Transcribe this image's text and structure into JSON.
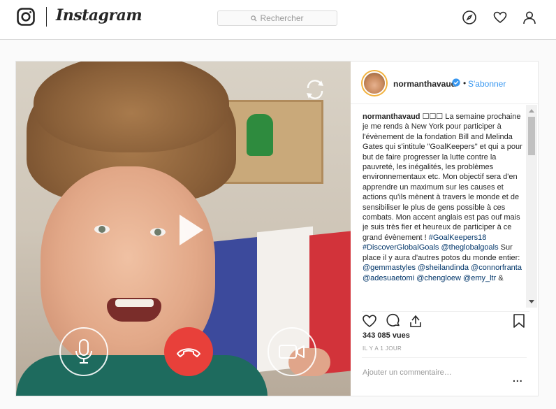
{
  "header": {
    "wordmark": "Instagram",
    "search_placeholder": "Rechercher",
    "icons": [
      "instagram-glyph-icon",
      "compass-icon",
      "heart-icon",
      "profile-icon"
    ]
  },
  "post": {
    "author": {
      "username": "normanthavaud",
      "verified": true,
      "separator": "•",
      "follow_label": "S'abonner"
    },
    "video_controls": {
      "icons": [
        "play-icon",
        "microphone-icon",
        "hang-up-icon",
        "video-camera-icon",
        "reload-icon"
      ]
    },
    "caption": {
      "username": "normanthavaud",
      "emoji": "☐☐☐",
      "text": "La semaine prochaine je me rends à New York pour participer à l'évènement de la fondation Bill and Melinda Gates qui s'intitule \"GoalKeepers\" et qui a pour but de faire progresser la lutte contre la pauvreté, les inégalités, les problèmes environnementaux etc. Mon objectif sera d'en apprendre un maximum sur les causes et actions qu'ils mènent à travers le monde et de sensibiliser le plus de gens possible à ces combats. Mon accent anglais est pas ouf mais je suis très fier et heureux de participer à ce grand évènement !",
      "tags_line1": "#GoalKeepers18",
      "tags_line2": "#DiscoverGlobalGoals @theglobalgoals",
      "mid_text": "Sur place il y aura d'autres potos du monde entier:",
      "tag_gemma": "@gemmastyles",
      "tag_sheil": "@sheilandinda",
      "tag_connor": "@connorfranta",
      "tag_ades": "@adesuaetomi",
      "tag_cheng": "@chengloew",
      "tag_emy": "@emy_ltr",
      "trailing": "&"
    },
    "actions": {
      "icons": [
        "like-icon",
        "comment-icon",
        "share-icon",
        "bookmark-icon"
      ]
    },
    "views": "343 085 vues",
    "timestamp": "IL Y A 1 JOUR",
    "comment_placeholder": "Ajouter un commentaire…",
    "more_label": "..."
  },
  "colors": {
    "link_blue": "#3897f0",
    "hangup_red": "#e8403a",
    "verified_blue": "#3897f0",
    "hashtag": "#003569"
  }
}
